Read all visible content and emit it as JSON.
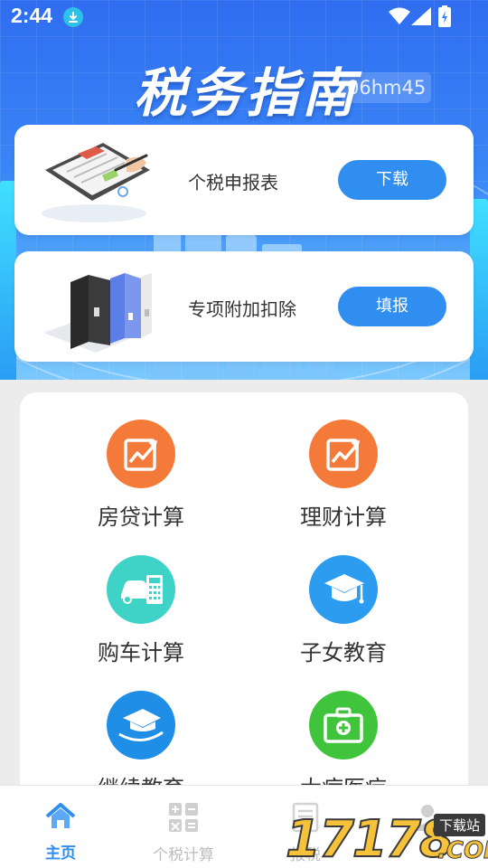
{
  "status_bar": {
    "time": "2:44"
  },
  "hero": {
    "title": "税务指南",
    "watermark": "06hm45"
  },
  "cards": [
    {
      "label": "个税申报表",
      "button": "下载",
      "illustration": "tax-form-illustration"
    },
    {
      "label": "专项附加扣除",
      "button": "填报",
      "illustration": "binders-illustration"
    }
  ],
  "grid": [
    {
      "label": "房贷计算",
      "icon": "chart-trend-icon",
      "color": "#f47a3a"
    },
    {
      "label": "理财计算",
      "icon": "chart-trend-icon",
      "color": "#f47a3a"
    },
    {
      "label": "购车计算",
      "icon": "car-calculator-icon",
      "color": "#3fd3c8"
    },
    {
      "label": "子女教育",
      "icon": "graduation-cap-icon",
      "color": "#2b9cf0"
    },
    {
      "label": "继续教育",
      "icon": "graduation-cap-icon",
      "color": "#1f8ee6"
    },
    {
      "label": "大病医疗",
      "icon": "medical-kit-icon",
      "color": "#3fc43b"
    }
  ],
  "tabs": [
    {
      "label": "主页",
      "icon": "home-icon",
      "active": true
    },
    {
      "label": "个税计算",
      "icon": "calculator-icon",
      "active": false
    },
    {
      "label": "报税",
      "icon": "document-icon",
      "active": false
    },
    {
      "label": "",
      "icon": "user-icon",
      "active": false
    }
  ],
  "watermark_logo": {
    "digits": "17178",
    "site": "下载站",
    "domain": ".COM"
  },
  "colors": {
    "accent": "#2f8ef0",
    "tab_active": "#2f8ef0",
    "tab_inactive": "#bdbdbd"
  }
}
